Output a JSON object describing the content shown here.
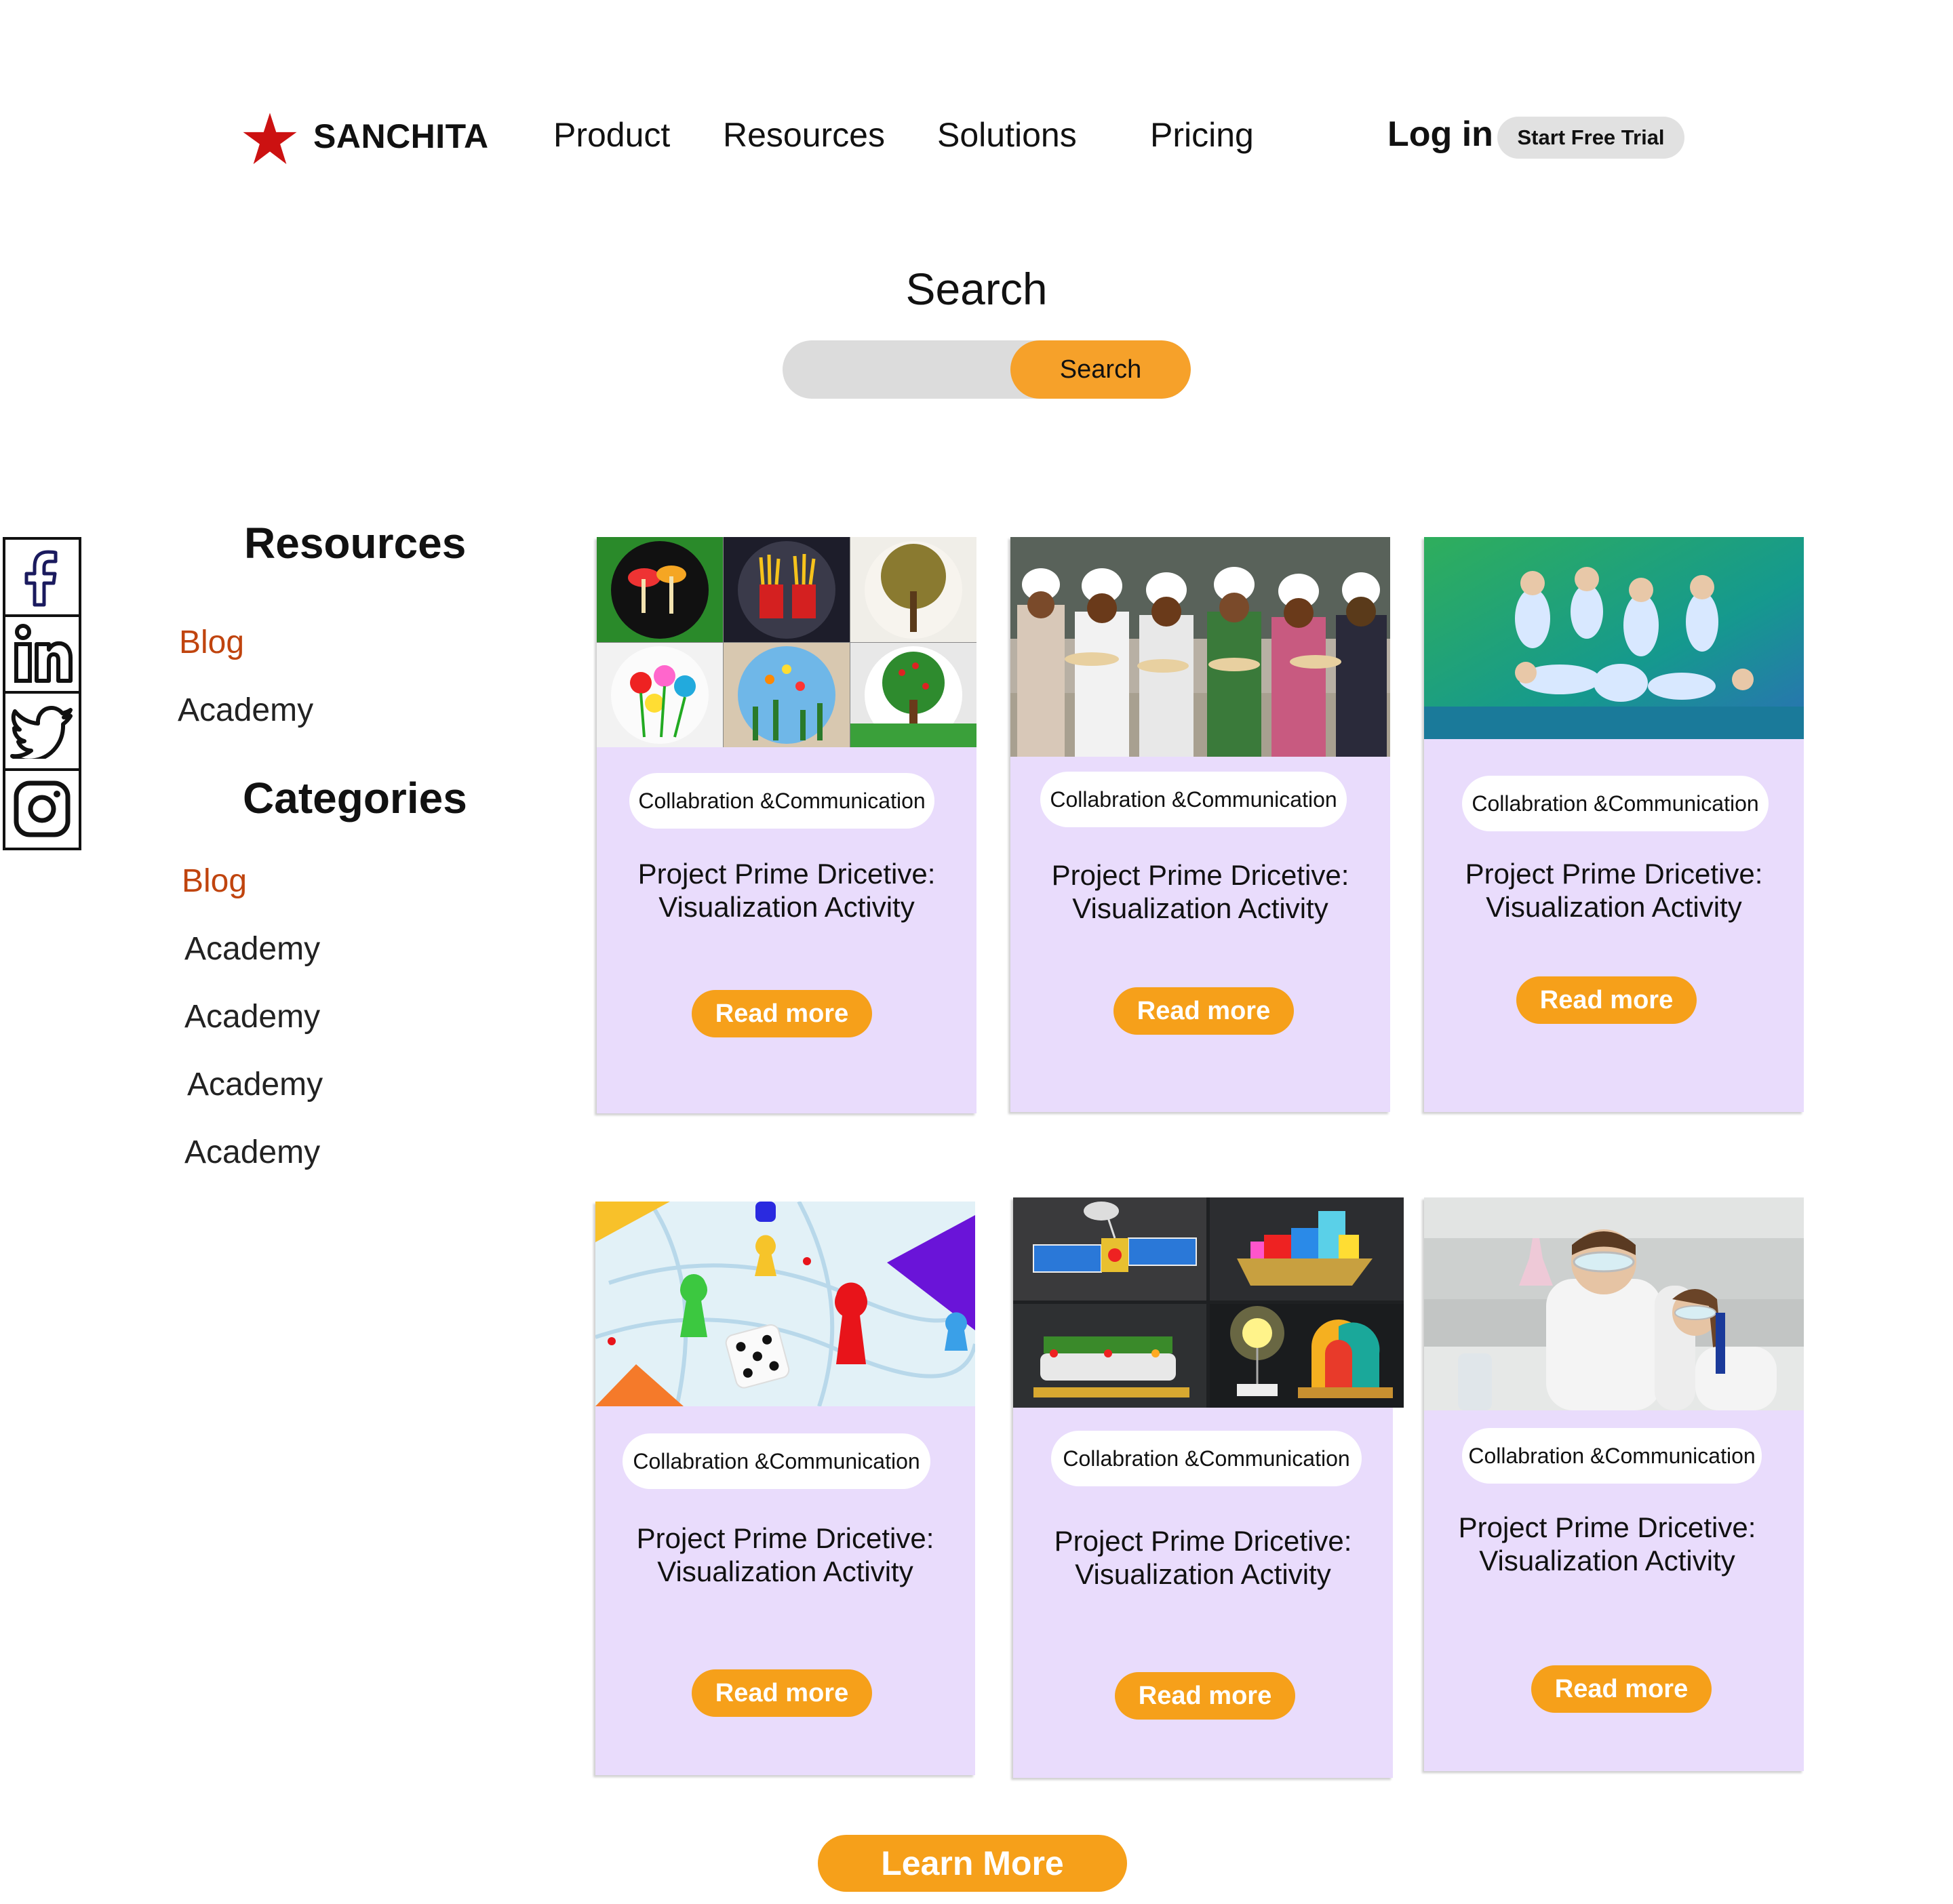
{
  "brand": {
    "name": "SANCHITA",
    "logo_icon": "star-icon",
    "logo_color": "#cc1111"
  },
  "nav": {
    "items": [
      "Product",
      "Resources",
      "Solutions",
      "Pricing"
    ],
    "login": "Log in",
    "trial": "Start Free Trial"
  },
  "search": {
    "title": "Search",
    "placeholder": "",
    "button": "Search",
    "button_color": "#f6a12a"
  },
  "social": [
    "facebook-icon",
    "linkedin-icon",
    "twitter-icon",
    "instagram-icon"
  ],
  "sidebar": {
    "resources_heading": "Resources",
    "resources": [
      {
        "label": "Blog",
        "active": true
      },
      {
        "label": "Academy",
        "active": false
      }
    ],
    "categories_heading": "Categories",
    "categories": [
      {
        "label": "Blog",
        "active": true
      },
      {
        "label": "Academy",
        "active": false
      },
      {
        "label": "Academy",
        "active": false
      },
      {
        "label": "Academy",
        "active": false
      },
      {
        "label": "Academy",
        "active": false
      }
    ],
    "active_color": "#c0440e"
  },
  "cards": [
    {
      "image": "craft-plates",
      "tag": "Collabration &Communication",
      "title": "Project Prime  Dricetive:\nVisualization Activity",
      "button": "Read more"
    },
    {
      "image": "kids-chefs",
      "tag": "Collabration &Communication",
      "title": "Project Prime  Dricetive:\nVisualization Activity",
      "button": "Read more"
    },
    {
      "image": "kids-dance",
      "tag": "Collabration &Communication",
      "title": "Project Prime  Dricetive:\nVisualization Activity",
      "button": "Read more"
    },
    {
      "image": "board-game",
      "tag": "Collabration &Communication",
      "title": "Project Prime  Dricetive:\nVisualization Activity",
      "button": "Read more"
    },
    {
      "image": "science-models",
      "tag": "Collabration &Communication",
      "title": "Project Prime  Dricetive:\nVisualization Activity",
      "button": "Read more"
    },
    {
      "image": "kids-lab",
      "tag": "Collabration &Communication",
      "title": "Project Prime  Dricetive:\nVisualization Activity",
      "button": "Read more"
    }
  ],
  "card_color": "#e9dcfc",
  "accent": "#f6a01a",
  "learn_more": "Learn More"
}
